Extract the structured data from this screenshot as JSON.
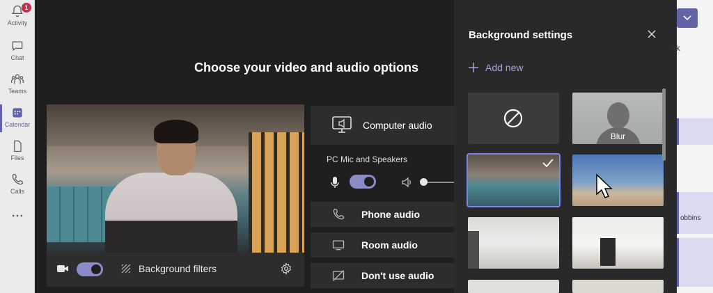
{
  "rail": {
    "items": [
      {
        "label": "Activity",
        "icon": "bell-icon",
        "badge": "1"
      },
      {
        "label": "Chat",
        "icon": "chat-icon"
      },
      {
        "label": "Teams",
        "icon": "teams-icon"
      },
      {
        "label": "Calendar",
        "icon": "calendar-icon",
        "active": true
      },
      {
        "label": "Files",
        "icon": "file-icon"
      },
      {
        "label": "Calls",
        "icon": "phone-icon"
      },
      {
        "label": "",
        "icon": "more-icon"
      }
    ]
  },
  "main": {
    "title": "Choose your video and audio options",
    "video": {
      "background_filters_label": "Background filters",
      "camera_on": true
    },
    "audio": {
      "computer_audio_label": "Computer audio",
      "device_label": "PC Mic and Speakers",
      "mic_on": true,
      "volume_level": 0.0,
      "phone_audio_label": "Phone audio",
      "room_audio_label": "Room audio",
      "no_audio_label": "Don't use audio"
    }
  },
  "panel": {
    "title": "Background settings",
    "add_new_label": "Add new",
    "tiles": [
      {
        "name": "none",
        "caption": ""
      },
      {
        "name": "blur",
        "caption": "Blur"
      },
      {
        "name": "office",
        "caption": "",
        "selected": true
      },
      {
        "name": "beach",
        "caption": ""
      },
      {
        "name": "room-1",
        "caption": ""
      },
      {
        "name": "room-2",
        "caption": ""
      },
      {
        "name": "room-3",
        "caption": ""
      },
      {
        "name": "room-4",
        "caption": ""
      }
    ]
  },
  "right_strip": {
    "week_label": "ek",
    "name_fragment": "obbins"
  },
  "colors": {
    "accent": "#6264a7",
    "toggle_on": "#8b8cc7",
    "selection": "#7f85f5",
    "badge": "#c4314b"
  }
}
